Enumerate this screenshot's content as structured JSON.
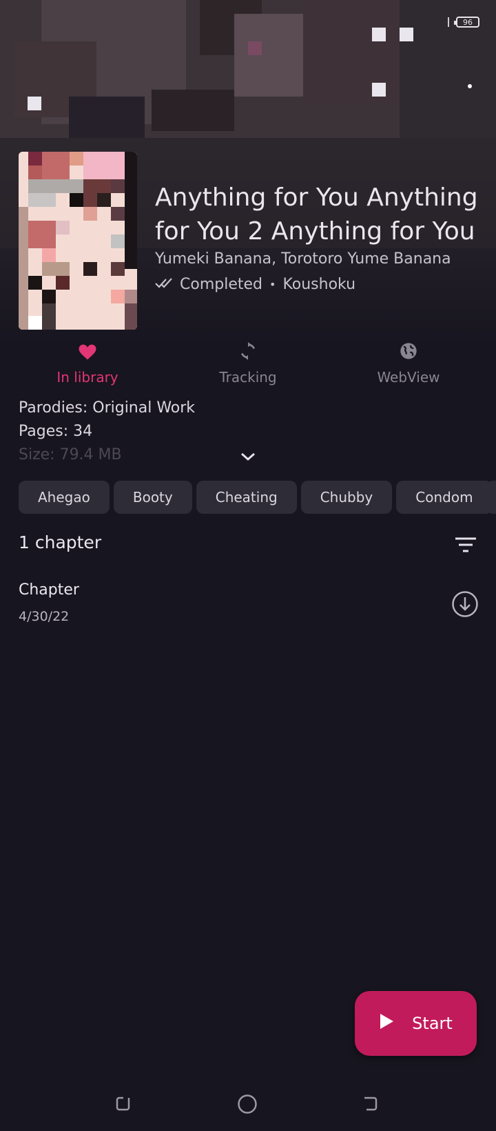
{
  "status_bar": {
    "battery": "96"
  },
  "manga": {
    "title": "Anything for You Anything for You 2 Anything for You",
    "authors": "Yumeki Banana, Torotoro Yume Banana",
    "status": "Completed",
    "separator": "•",
    "source": "Koushoku"
  },
  "actions": [
    {
      "label": "In library",
      "icon": "heart-icon"
    },
    {
      "label": "Tracking",
      "icon": "sync-icon"
    },
    {
      "label": "WebView",
      "icon": "globe-icon"
    }
  ],
  "details": {
    "parodies": "Parodies: Original Work",
    "pages": "Pages: 34",
    "size": "Size: 79.4 MB"
  },
  "tags": [
    "Ahegao",
    "Booty",
    "Cheating",
    "Chubby",
    "Condom"
  ],
  "chapters": {
    "count_label": "1 chapter",
    "items": [
      {
        "title": "Chapter",
        "date": "4/30/22"
      }
    ]
  },
  "fab": {
    "label": "Start"
  },
  "colors": {
    "accent": "#e33676",
    "fab": "#c21b5c",
    "background": "#17151f"
  }
}
